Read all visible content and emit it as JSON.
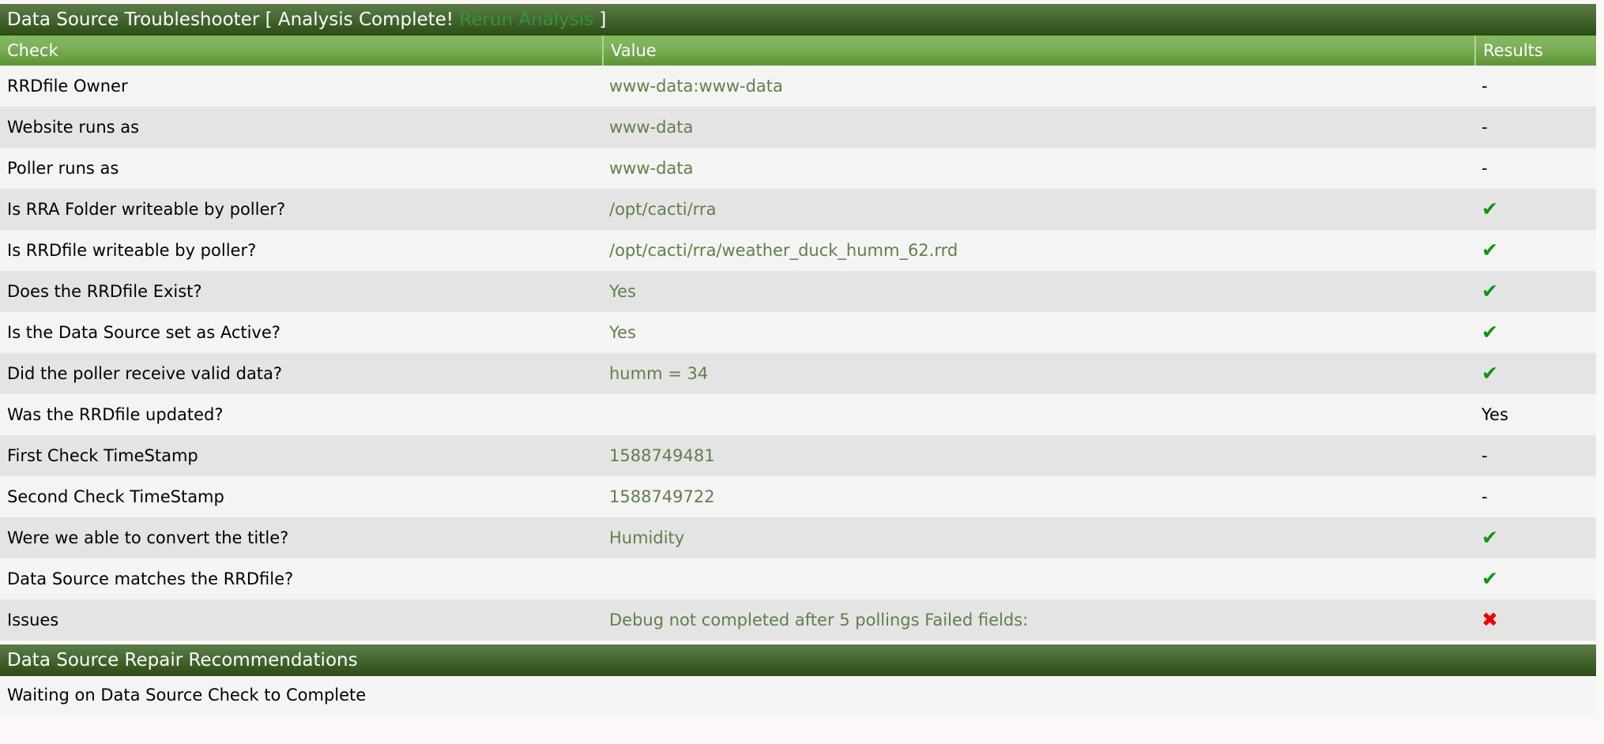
{
  "header": {
    "title_prefix": "Data Source Troubleshooter [ ",
    "status": "Analysis Complete!",
    "rerun_label": "Rerun Analysis",
    "title_suffix": " ]",
    "bar_gradient_top": "#5c7d47",
    "bar_gradient_bottom": "#2d4b15",
    "link_color": "#35923c"
  },
  "table": {
    "columns": [
      "Check",
      "Value",
      "Results"
    ],
    "header_gradient_top": "#85b960",
    "header_gradient_bottom": "#5d9434",
    "value_text_color": "#5f8049",
    "ok_color": "#119411",
    "bad_color": "#f50000",
    "rows": [
      {
        "check": "RRDfile Owner",
        "value": "www-data:www-data",
        "result": "-",
        "result_kind": "dash"
      },
      {
        "check": "Website runs as",
        "value": "www-data",
        "result": "-",
        "result_kind": "dash"
      },
      {
        "check": "Poller runs as",
        "value": "www-data",
        "result": "-",
        "result_kind": "dash"
      },
      {
        "check": "Is RRA Folder writeable by poller?",
        "value": "/opt/cacti/rra",
        "result": "✔",
        "result_kind": "ok"
      },
      {
        "check": "Is RRDfile writeable by poller?",
        "value": "/opt/cacti/rra/weather_duck_humm_62.rrd",
        "result": "✔",
        "result_kind": "ok"
      },
      {
        "check": "Does the RRDfile Exist?",
        "value": "Yes",
        "result": "✔",
        "result_kind": "ok"
      },
      {
        "check": "Is the Data Source set as Active?",
        "value": "Yes",
        "result": "✔",
        "result_kind": "ok"
      },
      {
        "check": "Did the poller receive valid data?",
        "value": "humm = 34",
        "result": "✔",
        "result_kind": "ok"
      },
      {
        "check": "Was the RRDfile updated?",
        "value": "",
        "result": "Yes",
        "result_kind": "text"
      },
      {
        "check": "First Check TimeStamp",
        "value": "1588749481",
        "result": "-",
        "result_kind": "dash"
      },
      {
        "check": "Second Check TimeStamp",
        "value": "1588749722",
        "result": "-",
        "result_kind": "dash"
      },
      {
        "check": "Were we able to convert the title?",
        "value": "Humidity",
        "result": "✔",
        "result_kind": "ok"
      },
      {
        "check": "Data Source matches the RRDfile?",
        "value": "",
        "result": "✔",
        "result_kind": "ok"
      },
      {
        "check": "Issues",
        "value": "Debug not completed after 5 pollings Failed fields:",
        "result": "✖",
        "result_kind": "bad"
      }
    ]
  },
  "recommendations": {
    "section_title": "Data Source Repair Recommendations",
    "note": "Waiting on Data Source Check to Complete"
  }
}
